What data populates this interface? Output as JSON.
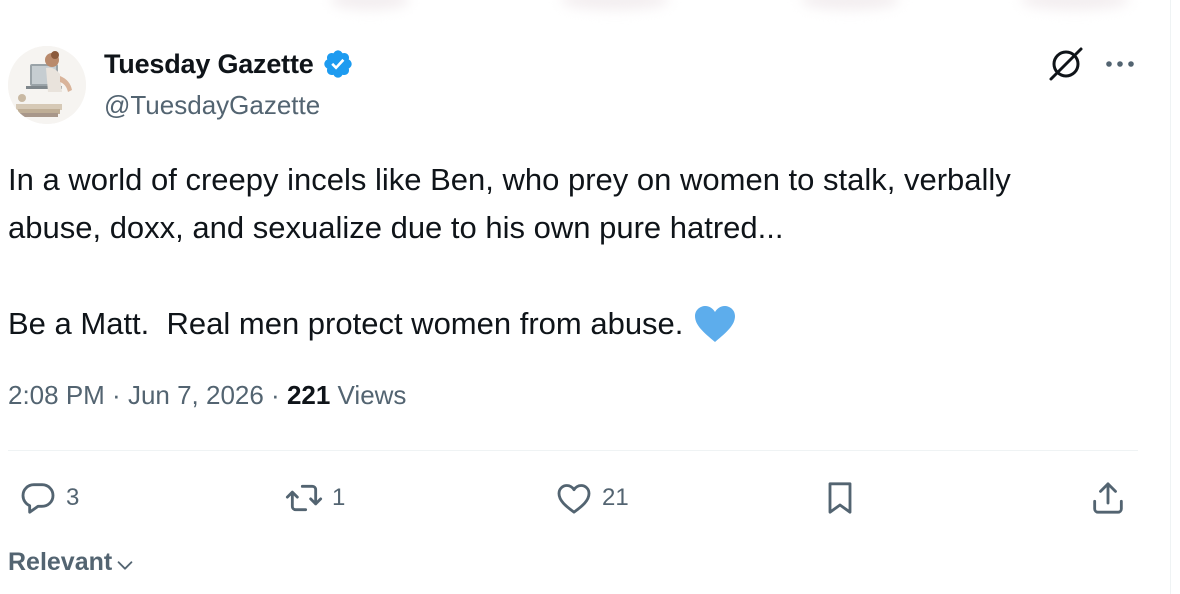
{
  "author": {
    "display_name": "Tuesday Gazette",
    "handle": "@TuesdayGazette",
    "verified": true,
    "verified_color": "#1d9bf0"
  },
  "tweet": {
    "line1": "In a world of creepy incels like Ben, who prey on women to stalk, verbally",
    "line2": "abuse, doxx, and sexualize due to his own pure hatred...",
    "line3": "Be a Matt.  Real men protect women from abuse.",
    "emoji": "blue-heart-icon",
    "emoji_color": "#5dadec"
  },
  "meta": {
    "time": "2:08 PM",
    "sep1": " · ",
    "date": "Jun 7, 2026",
    "sep2": " · ",
    "views_count": "221",
    "views_label": " Views"
  },
  "actions": {
    "replies": "3",
    "reposts": "1",
    "likes": "21"
  },
  "sort": {
    "label": "Relevant"
  },
  "icons": [
    "grok-icon",
    "more-icon",
    "reply-icon",
    "repost-icon",
    "like-icon",
    "bookmark-icon",
    "share-icon",
    "chevron-down-icon"
  ],
  "colors": {
    "text": "#0f1419",
    "secondary": "#536471",
    "divider": "#eff3f4"
  }
}
